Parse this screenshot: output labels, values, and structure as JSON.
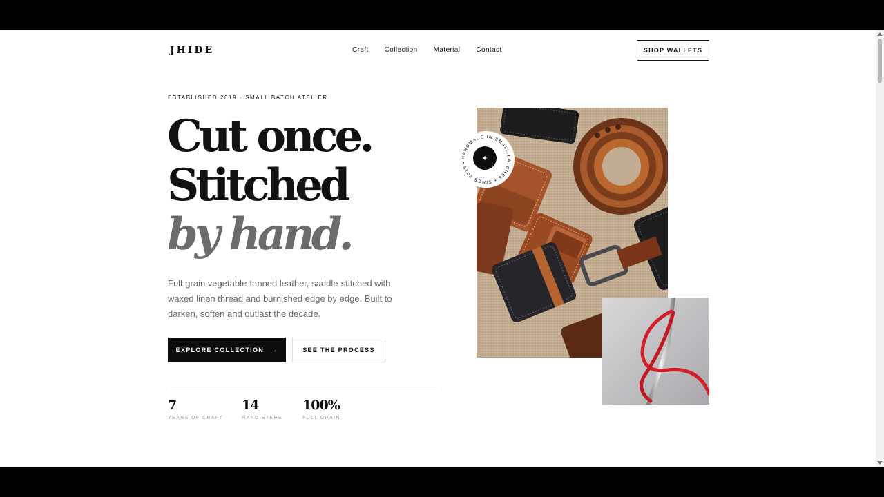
{
  "brand": {
    "logo": "JHIDE"
  },
  "nav": {
    "items": [
      {
        "label": "Craft"
      },
      {
        "label": "Collection"
      },
      {
        "label": "Material"
      },
      {
        "label": "Contact"
      }
    ],
    "cta": "SHOP WALLETS"
  },
  "hero": {
    "eyebrow": "ESTABLISHED 2019 · SMALL BATCH ATELIER",
    "headline": {
      "line1": "Cut once.",
      "line2": "Stitched",
      "line3": "by hand."
    },
    "lede": "Full-grain vegetable-tanned leather, saddle-stitched with waxed linen thread and burnished edge by edge. Built to darken, soften and outlast the decade.",
    "primary_cta": "EXPLORE COLLECTION",
    "primary_cta_arrow": "→",
    "secondary_cta": "SEE THE PROCESS"
  },
  "stats": [
    {
      "value": "7",
      "label": "YEARS OF CRAFT"
    },
    {
      "value": "14",
      "label": "HAND STEPS"
    },
    {
      "value": "100%",
      "label": "FULL GRAIN"
    }
  ],
  "badge": {
    "ring_text": "HANDMADE IN SMALL BATCHES • SINCE 2019 •",
    "center_glyph": "✦"
  },
  "colors": {
    "ink": "#111111",
    "muted": "#6b6b6b",
    "leather_tan": "#a8582c",
    "thread_red": "#d3202a"
  }
}
